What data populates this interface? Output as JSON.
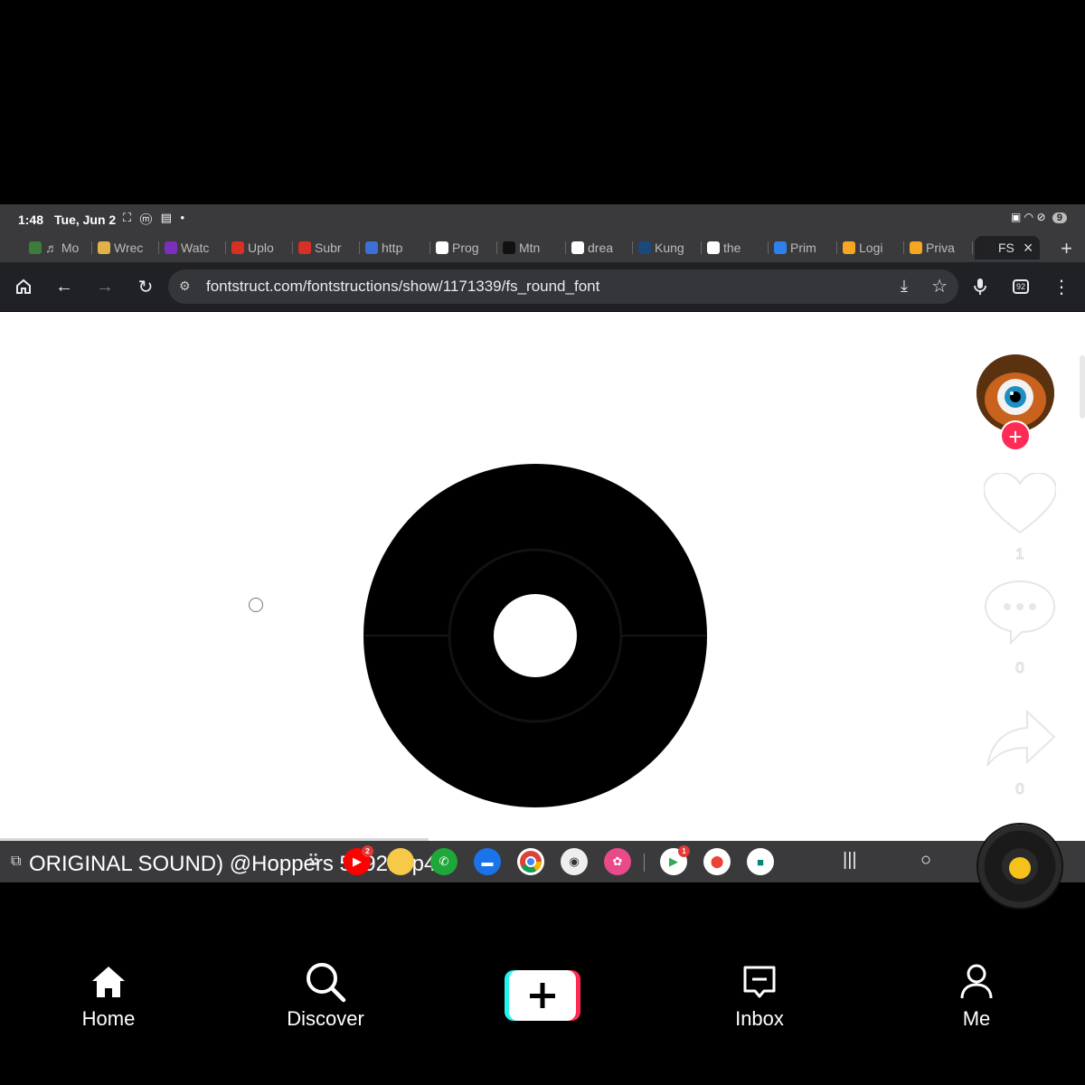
{
  "status_bar": {
    "time": "1:48",
    "date": "Tue, Jun 2",
    "battery": "9"
  },
  "tabs": [
    {
      "title": "♬ Mo",
      "favicon": "music-favicon",
      "color": "#3c7d3c"
    },
    {
      "title": "Wrec",
      "favicon": "egg-favicon",
      "color": "#e0b24a"
    },
    {
      "title": "Watc",
      "favicon": "watch-favicon",
      "color": "#7b2fbf"
    },
    {
      "title": "Uplo",
      "favicon": "f-favicon",
      "color": "#d93025"
    },
    {
      "title": "Subr",
      "favicon": "f-favicon",
      "color": "#d93025"
    },
    {
      "title": "http",
      "favicon": "mh-favicon",
      "color": "#3d6fd8"
    },
    {
      "title": "Prog",
      "favicon": "google-favicon",
      "color": "#ffffff"
    },
    {
      "title": "Mtn",
      "favicon": "capcut-favicon",
      "color": "#111111"
    },
    {
      "title": "drea",
      "favicon": "google-favicon",
      "color": "#ffffff"
    },
    {
      "title": "Kung",
      "favicon": "film-favicon",
      "color": "#1a4a7a"
    },
    {
      "title": "the",
      "favicon": "google-favicon",
      "color": "#ffffff"
    },
    {
      "title": "Prim",
      "favicon": "doc-favicon",
      "color": "#2f80ed"
    },
    {
      "title": "Logi",
      "favicon": "walmart-favicon",
      "color": "#f5a623"
    },
    {
      "title": "Priva",
      "favicon": "walmart-favicon",
      "color": "#f5a623"
    },
    {
      "title": "FS",
      "favicon": "fontstruct-favicon",
      "color": "#222222",
      "active": true
    }
  ],
  "browser": {
    "url": "fontstruct.com/fontstructions/show/1171339/fs_round_font",
    "tab_count": "92"
  },
  "video_actions": {
    "like_count": "1",
    "comment_count": "0",
    "share_count": "0"
  },
  "sound": {
    "text": "ORIGINAL SOUND) @Hoppers 5992.mp4"
  },
  "dock": {
    "youtube_badge": "2",
    "play_badge": "1"
  },
  "bottom_nav": {
    "home": "Home",
    "discover": "Discover",
    "inbox": "Inbox",
    "me": "Me"
  }
}
